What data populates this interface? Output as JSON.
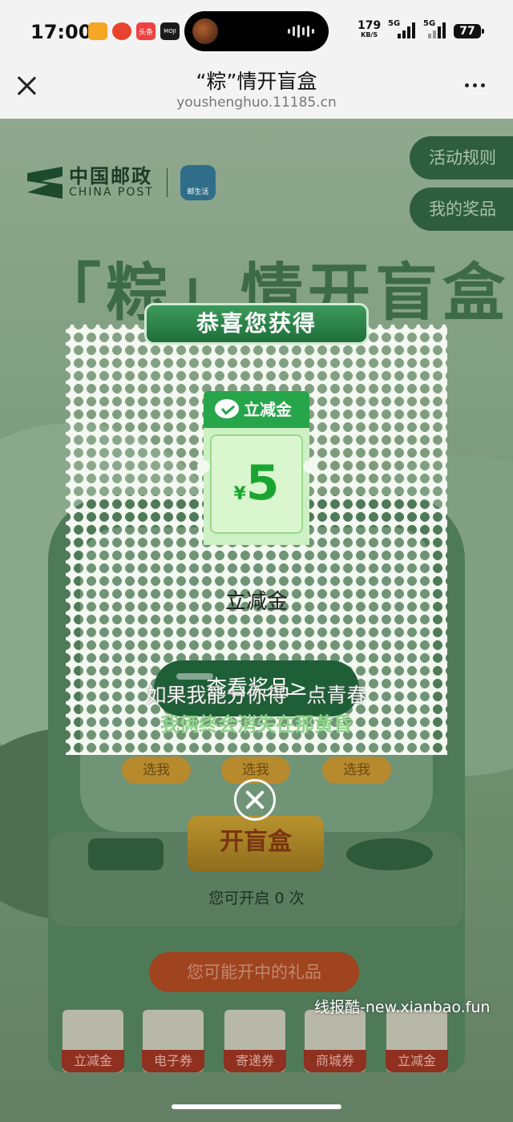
{
  "status_bar": {
    "time": "17:00",
    "net_speed": "179",
    "net_unit": "KB/S",
    "signal1_label": "5G",
    "signal2_label": "5G",
    "battery": "77",
    "apps": [
      {
        "label": "",
        "color": "#f5a623"
      },
      {
        "label": "",
        "color": "#e8432c"
      },
      {
        "label": "头条",
        "color": "#f04142"
      },
      {
        "label": "MOJI",
        "color": "#1a1a1a"
      }
    ]
  },
  "browser": {
    "title": "“粽”情开盲盒",
    "url": "youshenghuo.11185.cn"
  },
  "page": {
    "logo_cn": "中国邮政",
    "logo_en": "CHINA POST",
    "logo_app": "邮生活",
    "rules_button": "活动规则",
    "prizes_button": "我的奖品",
    "headline": "「粽」情开盲盒",
    "select_labels": [
      "选我",
      "选我",
      "选我"
    ],
    "open_button": "开盲盒",
    "open_count": "您可开启 0 次",
    "gifts_title": "您可能开中的礼品",
    "gifts": [
      "立减金",
      "电子券",
      "寄递券",
      "商城券",
      "立减金"
    ]
  },
  "modal": {
    "title": "恭喜您获得",
    "coupon_tag": "立减金",
    "currency": "¥",
    "amount": "5",
    "prize_name": "立减金",
    "view_button": "查看奖品>"
  },
  "overlay": {
    "lyric_line1": "如果我能分你得一点青春",
    "lyric_line2": "我俩终会消失在那黄昏",
    "watermark": "线报酷-new.xianbao.fun"
  },
  "colors": {
    "accent_green": "#1f6e3a",
    "coupon_green": "#27a54a",
    "gift_red": "#a0431f"
  }
}
